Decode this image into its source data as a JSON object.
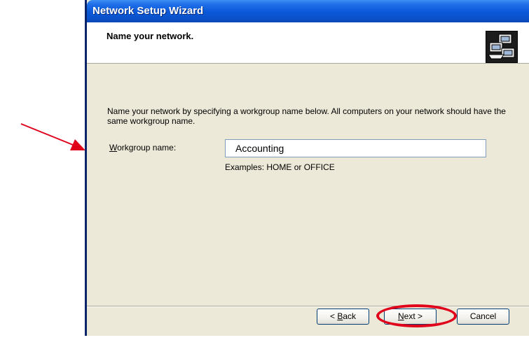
{
  "window": {
    "title": "Network Setup Wizard"
  },
  "header": {
    "heading": "Name your network.",
    "icon": "network-computers-icon"
  },
  "content": {
    "description": "Name your network by specifying a workgroup name below. All computers on your network should have the same workgroup name.",
    "workgroup_label_accesskey": "W",
    "workgroup_label_rest": "orkgroup name:",
    "workgroup_value": "Accounting",
    "examples": "Examples: HOME or OFFICE"
  },
  "buttons": {
    "back_prefix": "< ",
    "back_key": "B",
    "back_rest": "ack",
    "next_key": "N",
    "next_rest": "ext >",
    "cancel": "Cancel"
  },
  "annotations": {
    "arrow_color": "#E0001A",
    "ellipse_color": "#E0001A"
  }
}
